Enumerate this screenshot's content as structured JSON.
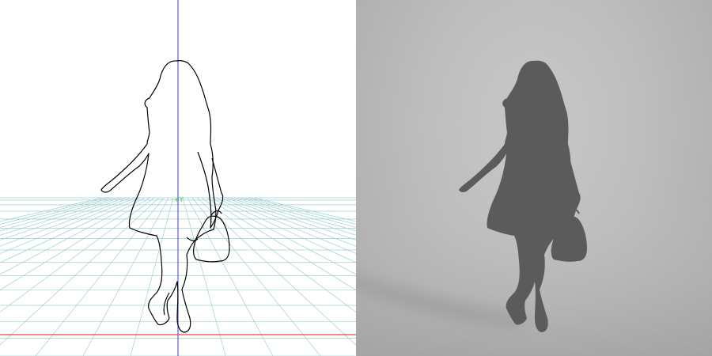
{
  "viewport": {
    "axis_marker": "+Y",
    "colors": {
      "grid": "#9ed0cf",
      "y_axis": "#5a5ad0",
      "x_axis": "#e04646",
      "outline": "#000000",
      "marker": "#33cc33"
    }
  },
  "render": {
    "colors": {
      "silhouette": "#5b5b5b",
      "shadow": "#8c8c8c",
      "background_top": "#c8c8c8",
      "background_bottom": "#a9a9a9"
    }
  }
}
